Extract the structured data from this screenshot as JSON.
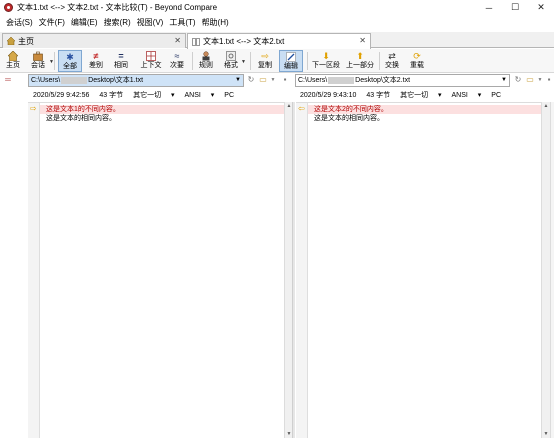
{
  "window": {
    "title": "文本1.txt <--> 文本2.txt - 文本比较(T) - Beyond Compare"
  },
  "menu": [
    "会话(S)",
    "文件(F)",
    "编辑(E)",
    "搜索(R)",
    "视图(V)",
    "工具(T)",
    "帮助(H)"
  ],
  "tabs": [
    {
      "label": "主页"
    },
    {
      "label": "文本1.txt <--> 文本2.txt"
    }
  ],
  "toolbar": {
    "home": "主页",
    "session": "会话",
    "all": "全部",
    "diffs": "差别",
    "same": "相同",
    "context": "上下文",
    "minor": "次要",
    "rules": "规则",
    "format": "格式",
    "copy": "复制",
    "edit": "编辑",
    "next_section": "下一区段",
    "prev_part": "上一部分",
    "swap": "交换",
    "reload": "重载"
  },
  "left": {
    "path_prefix": "C:\\Users\\",
    "path_suffix": "Desktop\\文本1.txt",
    "info": {
      "date": "2020/5/29 9:42:56",
      "size": "43 字节",
      "other": "其它一切",
      "encoding": "ANSI",
      "lineend": "PC"
    },
    "lines": [
      "这是文本1的不同内容。",
      "这是文本的相同内容。"
    ]
  },
  "right": {
    "path_prefix": "C:\\Users\\",
    "path_suffix": "Desktop\\文本2.txt",
    "info": {
      "date": "2020/5/29 9:43:10",
      "size": "43 字节",
      "other": "其它一切",
      "encoding": "ANSI",
      "lineend": "PC"
    },
    "lines": [
      "这是文本2的不同内容。",
      "这是文本的相同内容。"
    ]
  },
  "colors": {
    "diff_bg": "#fce0e0",
    "diff_text": "#b00000",
    "selected_path": "#cfe3f7",
    "pressed_button": "#c9def3"
  }
}
